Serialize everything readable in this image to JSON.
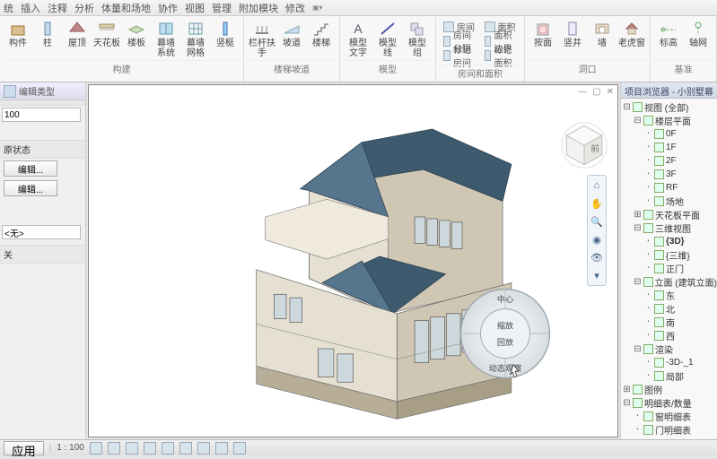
{
  "menu": [
    "统",
    "插入",
    "注释",
    "分析",
    "体量和场地",
    "协作",
    "视图",
    "管理",
    "附加模块",
    "修改"
  ],
  "ribbon_groups": [
    {
      "label": "构建",
      "buttons": [
        {
          "name": "component",
          "label": "构件"
        },
        {
          "name": "column",
          "label": "柱"
        },
        {
          "name": "roof",
          "label": "屋顶"
        },
        {
          "name": "ceiling",
          "label": "天花板"
        },
        {
          "name": "floor",
          "label": "楼板"
        },
        {
          "name": "curtain-system",
          "label": "幕墙\n系统"
        },
        {
          "name": "curtain-grid",
          "label": "幕墙\n网格"
        },
        {
          "name": "mullion",
          "label": "竖梃"
        }
      ]
    },
    {
      "label": "楼梯坡道",
      "buttons": [
        {
          "name": "railing",
          "label": "栏杆扶手"
        },
        {
          "name": "ramp",
          "label": "坡道"
        },
        {
          "name": "stair",
          "label": "楼梯"
        }
      ]
    },
    {
      "label": "模型",
      "buttons": [
        {
          "name": "model-text",
          "label": "模型\n文字"
        },
        {
          "name": "model-line",
          "label": "模型\n线"
        },
        {
          "name": "model-group",
          "label": "模型\n组"
        }
      ]
    },
    {
      "label": "房间和面积",
      "small": true,
      "cols": [
        [
          {
            "name": "room",
            "label": "房间"
          },
          {
            "name": "room-separator",
            "label": "房间\n分隔"
          },
          {
            "name": "tag-room",
            "label": "标记\n房间"
          }
        ],
        [
          {
            "name": "area",
            "label": "面积"
          },
          {
            "name": "area-boundary",
            "label": "面积 边界"
          },
          {
            "name": "tag-area",
            "label": "标记 面积"
          }
        ]
      ]
    },
    {
      "label": "洞口",
      "buttons": [
        {
          "name": "by-face",
          "label": "按面"
        },
        {
          "name": "shaft",
          "label": "竖井"
        },
        {
          "name": "wall-opening",
          "label": "墙"
        },
        {
          "name": "vertical",
          "label": "老虎窗"
        }
      ]
    },
    {
      "label": "基准",
      "buttons": [
        {
          "name": "level",
          "label": "标高"
        },
        {
          "name": "grid",
          "label": "轴网"
        }
      ]
    }
  ],
  "left_panel": {
    "edit_type": "编辑类型",
    "value_100": "100",
    "restore_state": "原状态",
    "edit_btn": "编辑...",
    "none": "<无>",
    "close": "关",
    "apply": "应用"
  },
  "viewport": {
    "corner_icons": [
      "minimize",
      "restore",
      "close"
    ],
    "viewcube_face": "前"
  },
  "wheel": {
    "center": "中心",
    "zoom": "缩放",
    "rewind": "回放",
    "orbit": "动态观察"
  },
  "nav_icons": [
    "home",
    "hand",
    "zoom",
    "orbit",
    "look",
    "chev"
  ],
  "browser": {
    "title": "项目浏览器 - 小别墅幕",
    "root": "视图 (全部)",
    "floor_plan": "楼层平面",
    "levels": [
      "0F",
      "1F",
      "2F",
      "3F",
      "RF",
      "场地"
    ],
    "ceiling_plan": "天花板平面",
    "threed": "三维视图",
    "threed_items": [
      {
        "l": "{3D}",
        "b": true
      },
      {
        "l": "{三维}",
        "b": false
      },
      {
        "l": "正门",
        "b": false
      }
    ],
    "elevation": "立面 (建筑立面)",
    "elev_items": [
      "东",
      "北",
      "南",
      "西"
    ],
    "render": "渲染",
    "render_items": [
      "-3D-_1",
      "局部"
    ],
    "legend": "图例",
    "schedule": "明细表/数量",
    "schedule_items": [
      "窗明细表",
      "门明细表"
    ]
  },
  "statusbar": {
    "apply": "应用",
    "scale": "1 : 100"
  }
}
